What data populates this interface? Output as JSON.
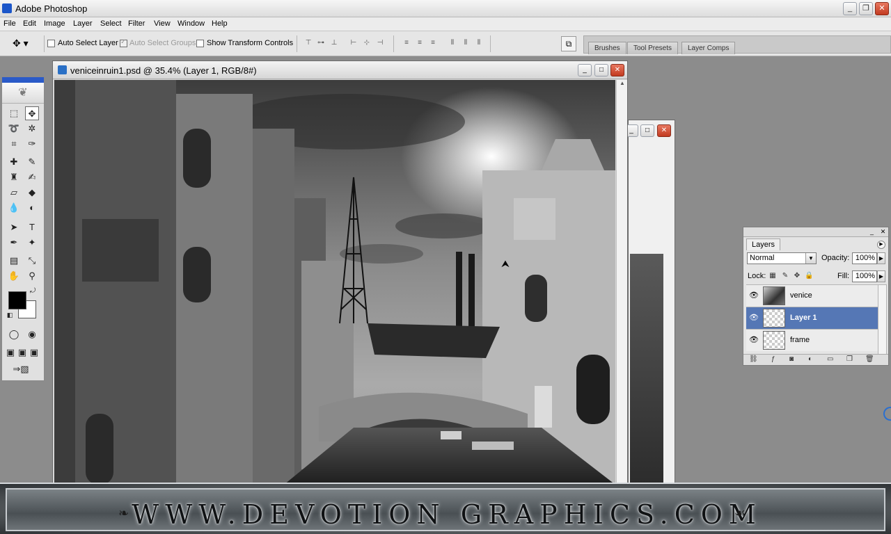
{
  "app": {
    "title": "Adobe Photoshop",
    "window_buttons": {
      "minimize": "_",
      "restore": "❐",
      "close": "✕"
    }
  },
  "menu": [
    "File",
    "Edit",
    "Image",
    "Layer",
    "Select",
    "Filter",
    "View",
    "Window",
    "Help"
  ],
  "options_bar": {
    "auto_select_layer": {
      "label": "Auto Select Layer",
      "checked": false
    },
    "auto_select_groups": {
      "label": "Auto Select Groups",
      "checked": true,
      "disabled": true
    },
    "show_transform_controls": {
      "label": "Show Transform Controls",
      "checked": false
    }
  },
  "palette_well": {
    "tabs": [
      "Brushes",
      "Tool Presets",
      "Layer Comps"
    ]
  },
  "document": {
    "title": "veniceinruin1.psd @ 35.4% (Layer 1, RGB/8#)"
  },
  "colors": {
    "foreground": "#000000",
    "background": "#ffffff",
    "selection": "#5577b5",
    "close_button": "#c23a20"
  },
  "layers_panel": {
    "tab": "Layers",
    "blend_mode": "Normal",
    "opacity_label": "Opacity:",
    "opacity": "100%",
    "lock_label": "Lock:",
    "fill_label": "Fill:",
    "fill": "100%",
    "layers": [
      {
        "name": "venice",
        "visible": true,
        "selected": false
      },
      {
        "name": "Layer 1",
        "visible": true,
        "selected": true
      },
      {
        "name": "frame",
        "visible": true,
        "selected": false
      }
    ]
  },
  "banner": {
    "text": "WWW.DEVOTION GRAPHICS.COM"
  }
}
